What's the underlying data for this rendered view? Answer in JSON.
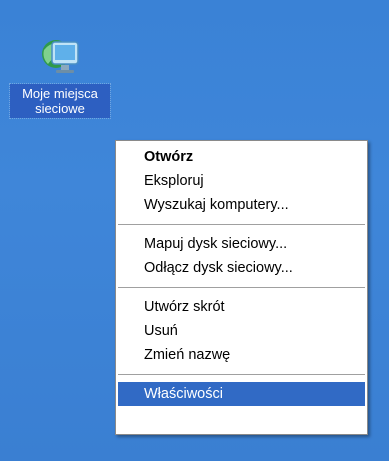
{
  "desktop_icon": {
    "label_line1": "Moje miejsca",
    "label_line2": "sieciowe",
    "icon": "network-places-icon"
  },
  "context_menu": {
    "groups": [
      [
        {
          "label": "Otwórz",
          "default": true
        },
        {
          "label": "Eksploruj"
        },
        {
          "label": "Wyszukaj komputery..."
        }
      ],
      [
        {
          "label": "Mapuj dysk sieciowy..."
        },
        {
          "label": "Odłącz dysk sieciowy..."
        }
      ],
      [
        {
          "label": "Utwórz skrót"
        },
        {
          "label": "Usuń"
        },
        {
          "label": "Zmień nazwę"
        }
      ],
      [
        {
          "label": "Właściwości",
          "selected": true
        }
      ]
    ]
  },
  "colors": {
    "desktop_bg": "#3a82d6",
    "selection": "#316ac5",
    "icon_label_bg": "#2d5fc1"
  }
}
